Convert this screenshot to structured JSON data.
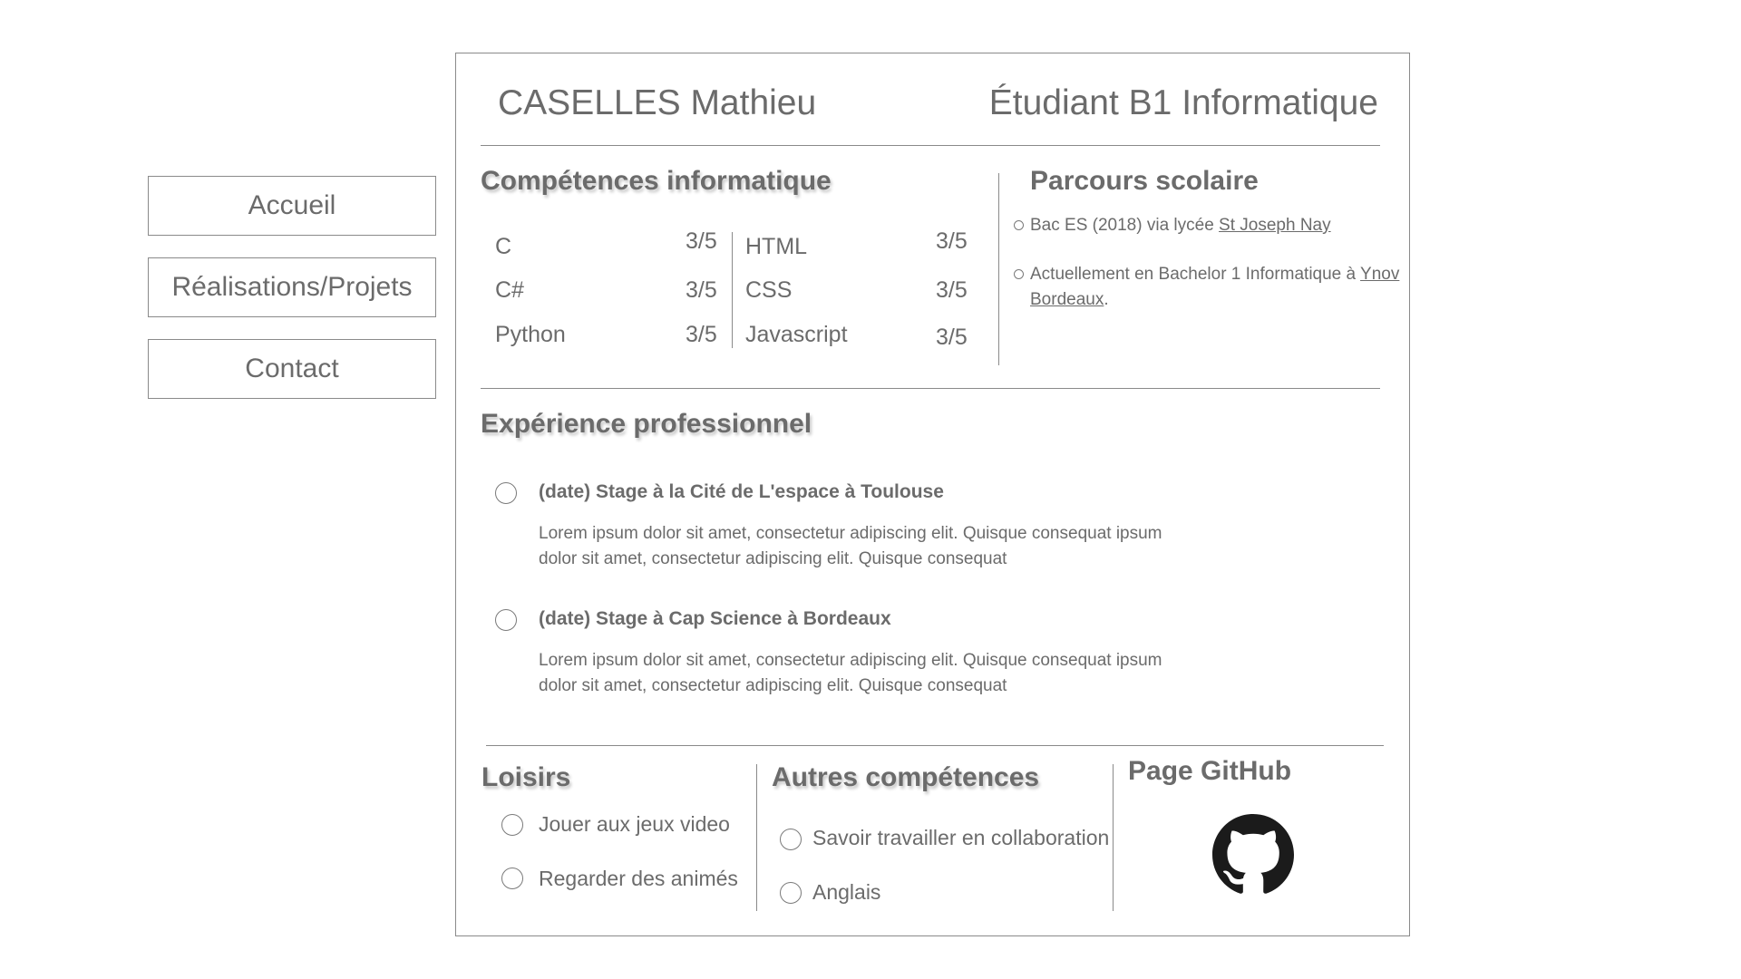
{
  "nav": {
    "items": [
      {
        "label": "Accueil"
      },
      {
        "label": "Réalisations/Projets"
      },
      {
        "label": "Contact"
      }
    ]
  },
  "header": {
    "name": "CASELLES Mathieu",
    "role": "Étudiant B1 Informatique"
  },
  "skills": {
    "title": "Compétences informatique",
    "left": [
      {
        "name": "C",
        "score": "3/5"
      },
      {
        "name": "C#",
        "score": "3/5"
      },
      {
        "name": "Python",
        "score": "3/5"
      }
    ],
    "right": [
      {
        "name": "HTML",
        "score": "3/5"
      },
      {
        "name": "CSS",
        "score": "3/5"
      },
      {
        "name": "Javascript",
        "score": "3/5"
      }
    ]
  },
  "school": {
    "title": "Parcours scolaire",
    "items": [
      {
        "text": "Bac ES (2018) via lycée ",
        "link": "St Joseph Nay",
        "suffix": ""
      },
      {
        "text": "Actuellement en Bachelor 1 Informatique à ",
        "link": "Ynov Bordeaux",
        "suffix": "."
      }
    ]
  },
  "experience": {
    "title": "Expérience professionnel",
    "items": [
      {
        "title": "(date) Stage à la Cité de L'espace à Toulouse",
        "desc": "Lorem ipsum dolor sit amet, consectetur adipiscing elit. Quisque consequat ipsum dolor sit amet, consectetur adipiscing elit. Quisque consequat"
      },
      {
        "title": "(date) Stage à Cap Science à Bordeaux",
        "desc": "Lorem ipsum dolor sit amet, consectetur adipiscing elit. Quisque consequat ipsum dolor sit amet, consectetur adipiscing elit. Quisque consequat"
      }
    ]
  },
  "hobbies": {
    "title": "Loisirs",
    "items": [
      "Jouer aux jeux video",
      "Regarder des animés"
    ]
  },
  "other_skills": {
    "title": "Autres compétences",
    "items": [
      "Savoir travailler en collaboration",
      "Anglais"
    ]
  },
  "github": {
    "title": "Page GitHub",
    "icon": "github-icon"
  }
}
